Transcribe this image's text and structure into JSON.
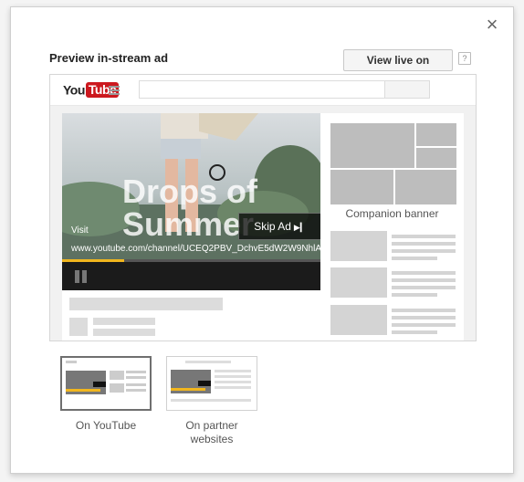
{
  "dialog": {
    "title": "Preview in-stream ad",
    "view_live_label": "View live on YouTube",
    "help_label": "?",
    "close_label": "×"
  },
  "youtube": {
    "logo_you": "You",
    "logo_tube": "Tube",
    "brand_color": "#cc181e"
  },
  "player": {
    "overlay_text_line1": "Drops of",
    "overlay_text_line2": "Summer",
    "visit_label": "Visit",
    "ad_url": "www.youtube.com/channel/UCEQ2PBV_DchvE5dW2W9NhlA",
    "skip_label": "Skip Ad",
    "skip_icon": "skip-next-icon",
    "progress_fraction": 0.24,
    "accent_color": "#f1b61e"
  },
  "sidebar": {
    "companion_label": "Companion banner"
  },
  "placements": [
    {
      "label": "On YouTube",
      "selected": true
    },
    {
      "label_line1": "On partner",
      "label_line2": "websites",
      "selected": false
    }
  ]
}
